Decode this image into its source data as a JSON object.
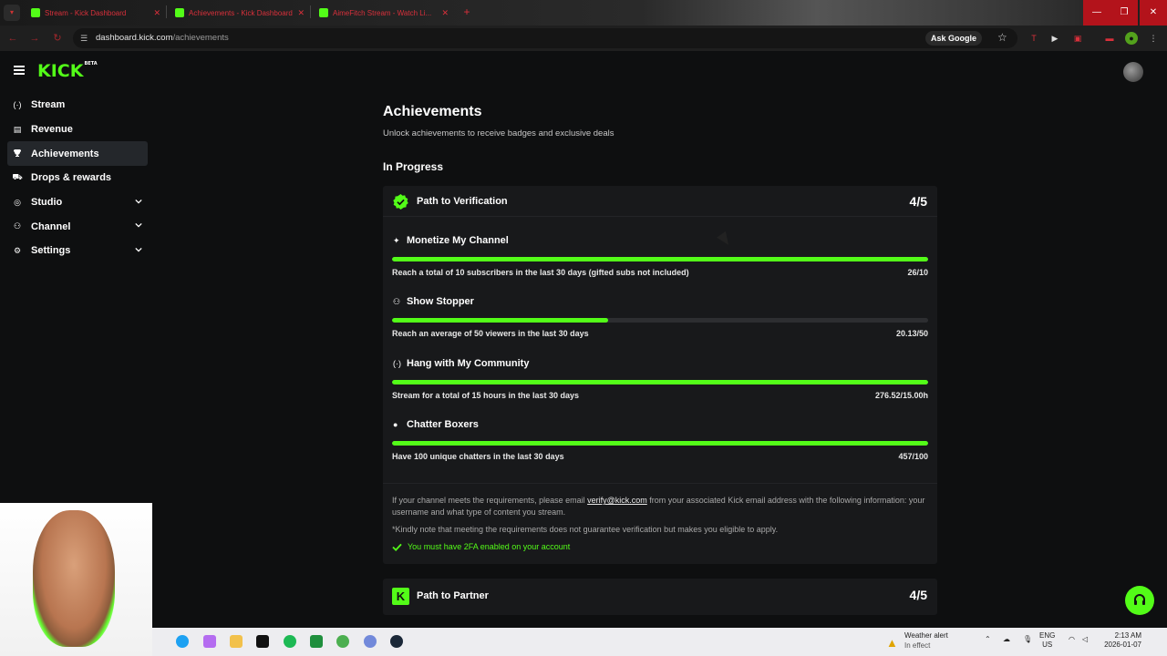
{
  "browser": {
    "tabs": [
      {
        "label": "Stream - Kick Dashboard"
      },
      {
        "label": "Achievements - Kick Dashboard"
      },
      {
        "label": "AimeFitch Stream - Watch Li..."
      }
    ],
    "url_host": "dashboard.kick.com",
    "url_path": "/achievements",
    "ask_google": "Ask Google"
  },
  "app": {
    "logo": "KICK",
    "logo_badge": "BETA"
  },
  "sidebar": {
    "items": [
      {
        "label": "Stream",
        "icon": "broadcast-icon",
        "glyph": "(·)",
        "expandable": false,
        "active": false
      },
      {
        "label": "Revenue",
        "icon": "revenue-icon",
        "glyph": "▤",
        "expandable": false,
        "active": false
      },
      {
        "label": "Achievements",
        "icon": "trophy-icon",
        "glyph": "🏆",
        "expandable": false,
        "active": true
      },
      {
        "label": "Drops & rewards",
        "icon": "gift-icon",
        "glyph": "⛟",
        "expandable": false,
        "active": false
      },
      {
        "label": "Studio",
        "icon": "studio-icon",
        "glyph": "◎",
        "expandable": true,
        "active": false
      },
      {
        "label": "Channel",
        "icon": "channel-icon",
        "glyph": "⚇",
        "expandable": true,
        "active": false
      },
      {
        "label": "Settings",
        "icon": "gear-icon",
        "glyph": "⚙",
        "expandable": true,
        "active": false
      }
    ]
  },
  "page": {
    "title": "Achievements",
    "subtitle": "Unlock achievements to receive badges and exclusive deals",
    "section_in_progress": "In Progress"
  },
  "verification_card": {
    "title": "Path to Verification",
    "count": "4/5",
    "achievements": [
      {
        "title": "Monetize My Channel",
        "icon": "sparkle-icon",
        "glyph": "✦",
        "description": "Reach a total of 10 subscribers in the last 30 days (gifted subs not included)",
        "value": "26/10",
        "progress": 1.0
      },
      {
        "title": "Show Stopper",
        "icon": "viewers-icon",
        "glyph": "⚇",
        "description": "Reach an average of 50 viewers in the last 30 days",
        "value": "20.13/50",
        "progress": 0.4026
      },
      {
        "title": "Hang with My Community",
        "icon": "broadcast-icon",
        "glyph": "(·)",
        "description": "Stream for a total of 15 hours in the last 30 days",
        "value": "276.52/15.00h",
        "progress": 1.0
      },
      {
        "title": "Chatter Boxers",
        "icon": "chat-icon",
        "glyph": "●",
        "description": "Have 100 unique chatters in the last 30 days",
        "value": "457/100",
        "progress": 1.0
      }
    ],
    "footer_text_before": "If your channel meets the requirements, please email ",
    "footer_email": "verify@kick.com",
    "footer_text_after": " from your associated Kick email address with the following information: your username and what type of content you stream.",
    "footer_note": "*Kindly note that meeting the requirements does not guarantee verification but makes you eligible to apply.",
    "requirement": "You must have 2FA enabled on your account"
  },
  "partner_card": {
    "title": "Path to Partner",
    "count": "4/5",
    "logo_letter": "K"
  },
  "taskbar": {
    "weather_title": "Weather alert",
    "weather_status": "In effect",
    "lang_line1": "ENG",
    "lang_line2": "US",
    "time": "2:13 AM",
    "date": "2026-01-07"
  },
  "colors": {
    "accent": "#53fc18",
    "background": "#0e0f10",
    "card": "#18191b",
    "track": "#2d2e31"
  }
}
